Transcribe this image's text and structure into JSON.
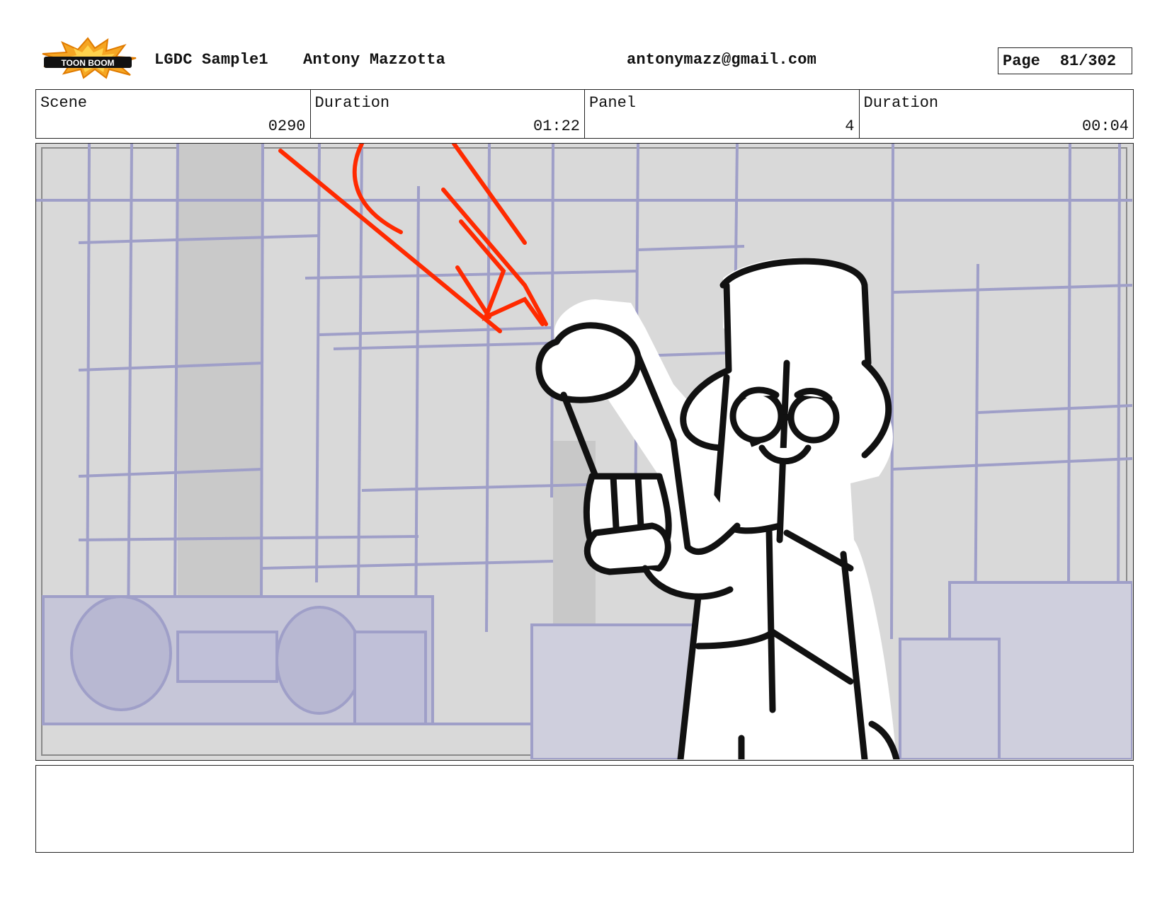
{
  "header": {
    "logo_text": "TOON BOOM",
    "project": "LGDC Sample1",
    "author": "Antony Mazzotta",
    "email": "antonymazz@gmail.com",
    "page_label": "Page",
    "page_value": "81/302"
  },
  "info": {
    "scene_label": "Scene",
    "scene_value": "0290",
    "scene_duration_label": "Duration",
    "scene_duration_value": "01:22",
    "panel_label": "Panel",
    "panel_value": "4",
    "panel_duration_label": "Duration",
    "panel_duration_value": "00:04"
  },
  "colors": {
    "background_line": "#9f9fc8",
    "background_fill": "#d9d9d9",
    "flash": "#ff2a00",
    "ink": "#111111"
  },
  "notes": {
    "text": ""
  }
}
